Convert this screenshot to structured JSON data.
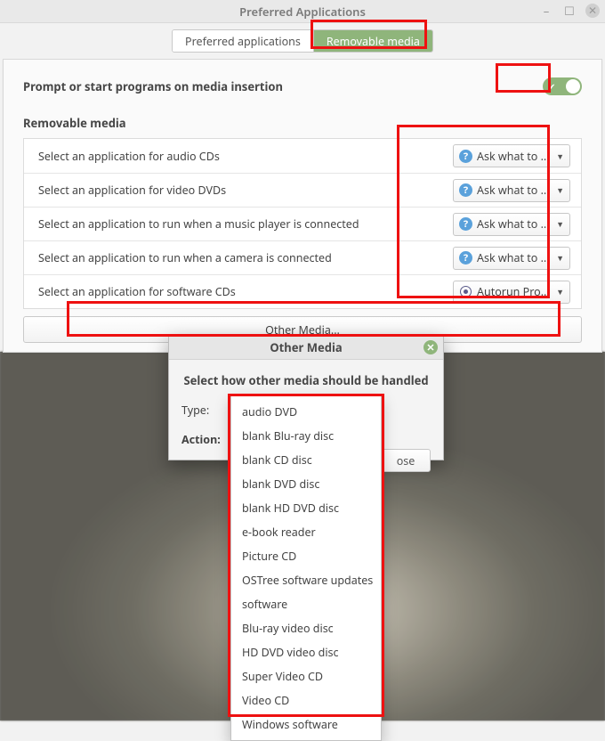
{
  "window": {
    "title": "Preferred Applications"
  },
  "tabs": {
    "inactive_label": "Preferred applications",
    "active_label": "Removable media"
  },
  "prompt": {
    "label": "Prompt or start programs on media insertion",
    "on": true
  },
  "section_title": "Removable media",
  "ask_label": "Ask what to do",
  "autorun_label": "Autorun Prompt",
  "media_rows": [
    {
      "label": "Select an application for audio CDs",
      "value_key": "ask"
    },
    {
      "label": "Select an application for video DVDs",
      "value_key": "ask"
    },
    {
      "label": "Select an application to run when a music player is connected",
      "value_key": "ask"
    },
    {
      "label": "Select an application to run when a camera is connected",
      "value_key": "ask"
    },
    {
      "label": "Select an application for software CDs",
      "value_key": "autorun"
    }
  ],
  "other_button": "Other Media...",
  "dialog": {
    "title": "Other Media",
    "subtitle": "Select how other media should be handled",
    "type_label": "Type:",
    "action_label": "Action:",
    "close_label": "ose"
  },
  "type_options": [
    "audio DVD",
    "blank Blu-ray disc",
    "blank CD disc",
    "blank DVD disc",
    "blank HD DVD disc",
    "e-book reader",
    "Picture CD",
    "OSTree software updates",
    "software",
    "Blu-ray video disc",
    "HD DVD video disc",
    "Super Video CD",
    "Video CD",
    "Windows software"
  ]
}
